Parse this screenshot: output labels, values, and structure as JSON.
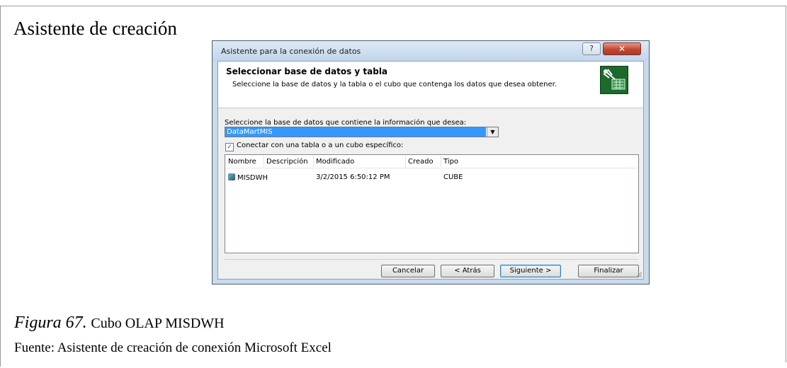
{
  "page": {
    "heading": "Asistente de creación",
    "figure_number": "Figura 67.",
    "figure_title": "Cubo OLAP MISDWH",
    "source": "Fuente: Asistente de creación de conexión Microsoft Excel"
  },
  "dialog": {
    "title": "Asistente para la conexión de datos",
    "help_label": "?",
    "close_label": "✕",
    "step_title": "Seleccionar base de datos y tabla",
    "step_description": "Seleccione la base de datos y la tabla o el cubo que contenga los datos que desea obtener.",
    "wizard_icon": "data-connection-wizard-icon",
    "database_label": "Seleccione la base de datos que contiene la información que desea:",
    "database_value": "DataMartMIS",
    "dropdown_glyph": "▼",
    "connect_checked": true,
    "check_glyph": "✓",
    "connect_label": "Conectar con una tabla o a un cubo específico:",
    "table": {
      "columns": [
        "Nombre",
        "Descripción",
        "Modificado",
        "Creado",
        "Tipo"
      ],
      "rows": [
        {
          "name": "MISDWH",
          "description": "",
          "modified": "3/2/2015 6:50:12 PM",
          "created": "",
          "type": "CUBE",
          "icon": "cube-icon"
        }
      ]
    },
    "buttons": {
      "cancel": "Cancelar",
      "back": "< Atrás",
      "next": "Siguiente >",
      "finish": "Finalizar"
    }
  },
  "colors": {
    "selection": "#3399ff",
    "close_button": "#c24733",
    "dialog_frame": "#c9daea"
  }
}
